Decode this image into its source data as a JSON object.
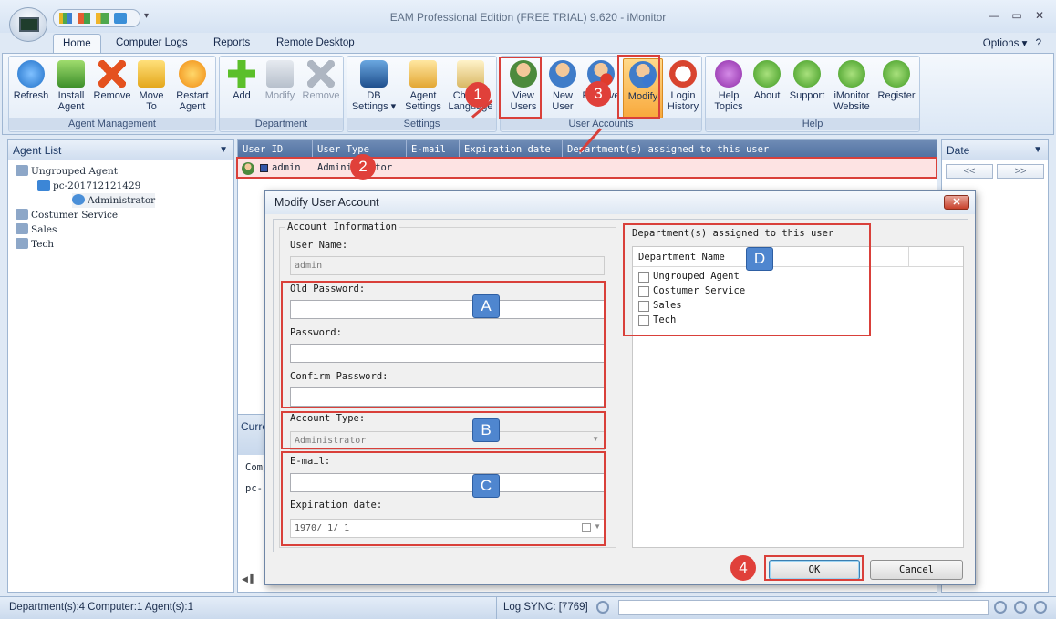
{
  "window": {
    "title": "EAM Professional Edition (FREE TRIAL) 9.620 - iMonitor"
  },
  "tabs": [
    "Home",
    "Computer Logs",
    "Reports",
    "Remote Desktop"
  ],
  "options_label": "Options",
  "ribbon": {
    "agent_management": {
      "label": "Agent Management",
      "buttons": [
        "Refresh",
        "Install Agent",
        "Remove",
        "Move To",
        "Restart Agent"
      ]
    },
    "department": {
      "label": "Department",
      "buttons": [
        "Add",
        "Modify",
        "Remove"
      ]
    },
    "settings": {
      "label": "Settings",
      "buttons": [
        "DB Settings",
        "Agent Settings",
        "Change Language"
      ]
    },
    "user_accounts": {
      "label": "User Accounts",
      "buttons": [
        "View Users",
        "New User",
        "Remove",
        "Modify",
        "Login History"
      ]
    },
    "help": {
      "label": "Help",
      "buttons": [
        "Help Topics",
        "About",
        "Support",
        "iMonitor Website",
        "Register"
      ]
    }
  },
  "agent_list": {
    "title": "Agent List",
    "tree": [
      "Ungrouped Agent",
      "pc-201712121429",
      "Administrator",
      "Costumer Service",
      "Sales",
      "Tech"
    ]
  },
  "users_grid": {
    "columns": [
      "User ID",
      "User Type",
      "E-mail",
      "Expiration date",
      "Department(s) assigned to this user"
    ],
    "rows": [
      {
        "user_id": "admin",
        "user_type": "Administrator"
      }
    ]
  },
  "current_tab_partial": "Curre",
  "lower_grid_partial": [
    "Comp",
    "pc-"
  ],
  "date_panel": {
    "title": "Date",
    "prev": "<<",
    "next": ">>"
  },
  "dialog": {
    "title": "Modify User Account",
    "account_info_legend": "Account Information",
    "user_name_label": "User Name:",
    "user_name_value": "admin",
    "old_password_label": "Old Password:",
    "password_label": "Password:",
    "confirm_password_label": "Confirm Password:",
    "account_type_label": "Account Type:",
    "account_type_value": "Administrator",
    "email_label": "E-mail:",
    "expiration_label": "Expiration date:",
    "expiration_value": "1970/ 1/ 1",
    "dept_section_title": "Department(s) assigned to this user",
    "dept_column": "Department Name",
    "departments": [
      "Ungrouped Agent",
      "Costumer Service",
      "Sales",
      "Tech"
    ],
    "ok_label": "OK",
    "cancel_label": "Cancel"
  },
  "status": {
    "summary": "Department(s):4  Computer:1  Agent(s):1",
    "log_sync": "Log SYNC: [7769]"
  },
  "annotations": {
    "tags": [
      "A",
      "B",
      "C",
      "D"
    ],
    "steps": [
      "1",
      "2",
      "3",
      "4"
    ]
  },
  "colors": {
    "annotation_red": "#d9403a",
    "tag_blue": "#4f86cf",
    "selected_orange": "#f8a93c"
  }
}
